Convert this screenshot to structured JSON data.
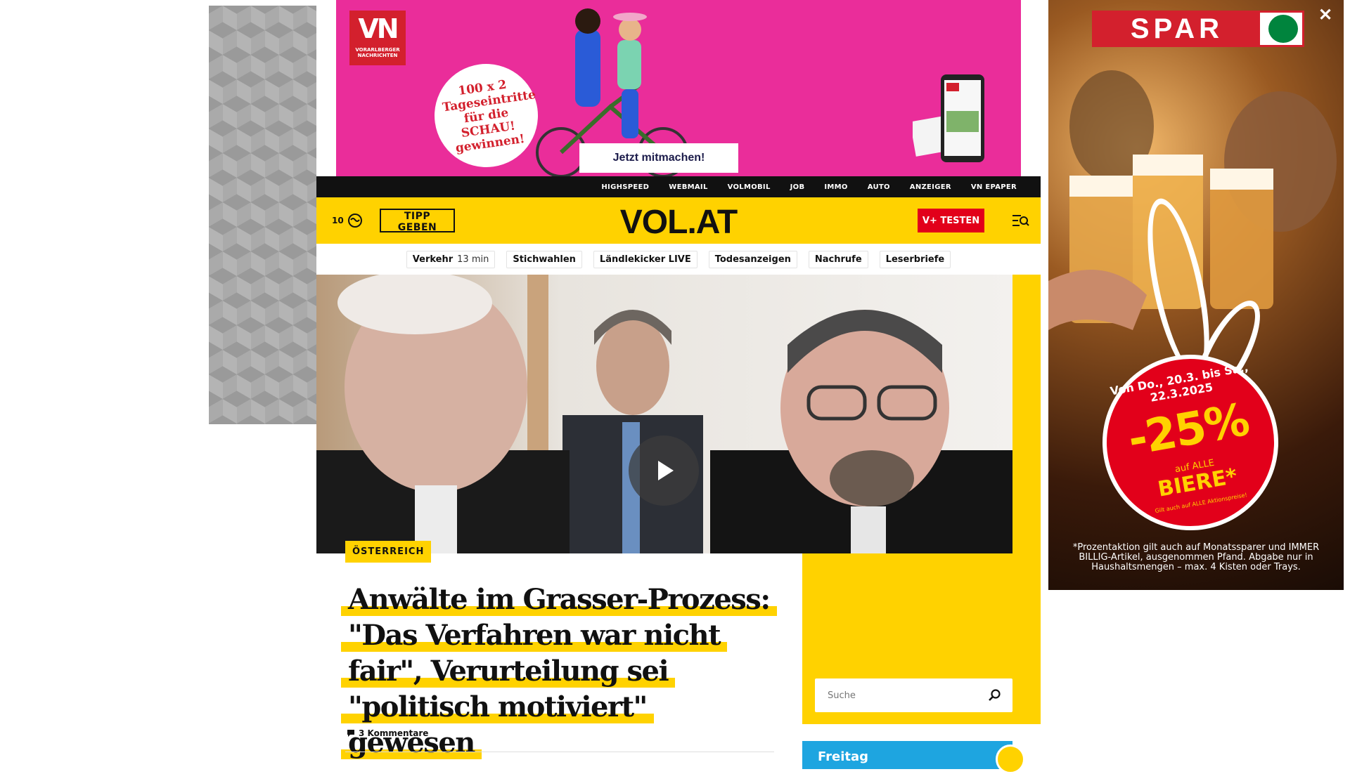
{
  "colors": {
    "brand_yellow": "#ffd200",
    "banner_pink": "#ea2d9a",
    "vplus_red": "#e2001a",
    "nav_black": "#111111",
    "weather_blue": "#1ea5e0"
  },
  "top_banner": {
    "logo_mark": "VN",
    "logo_sub": "VORARLBERGER NACHRICHTEN",
    "badge_text": "100 x 2 Tageseintritte für die SCHAU! gewinnen!",
    "cta_label": "Jetzt mitmachen!"
  },
  "top_nav": {
    "items": [
      "HIGHSPEED",
      "WEBMAIL",
      "VOLMOBIL",
      "JOB",
      "IMMO",
      "AUTO",
      "ANZEIGER",
      "VN EPAPER"
    ]
  },
  "header": {
    "weather_temp": "10",
    "weather_icon": "cloud-icon",
    "tipp_label": "TIPP GEBEN",
    "logo": "VOL.AT",
    "vplus_label": "V+ TESTEN",
    "menu_icon": "menu-search-icon"
  },
  "quicklinks": {
    "verkehr_label": "Verkehr",
    "verkehr_time": "13 min",
    "items": [
      "Stichwahlen",
      "Ländlekicker LIVE",
      "Todesanzeigen",
      "Nachrufe",
      "Leserbriefe"
    ]
  },
  "hero": {
    "play_icon": "play-icon"
  },
  "article": {
    "category": "ÖSTERREICH",
    "headline": "Anwälte im Grasser-Prozess: \"Das Verfahren war nicht fair\", Verurteilung sei \"politisch motiviert\" gewesen",
    "comments": "3 Kommentare",
    "comment_icon": "comment-icon"
  },
  "sidebar": {
    "search_placeholder": "Suche",
    "search_icon": "search-icon",
    "weather_day": "Freitag"
  },
  "spar_ad": {
    "logo": "SPAR",
    "close_icon": "close-icon",
    "date_text": "Von Do., 20.3. bis Sa., 22.3.2025",
    "discount": "-25%",
    "line1": "auf ALLE",
    "line2": "BIERE*",
    "small": "Gilt auch auf ALLE Aktionspreise!",
    "fine_print": "*Prozentaktion gilt auch auf Monatssparer und IMMER BILLIG-Artikel, ausgenommen Pfand. Abgabe nur in Haushaltsmengen – max. 4 Kisten oder Trays."
  }
}
